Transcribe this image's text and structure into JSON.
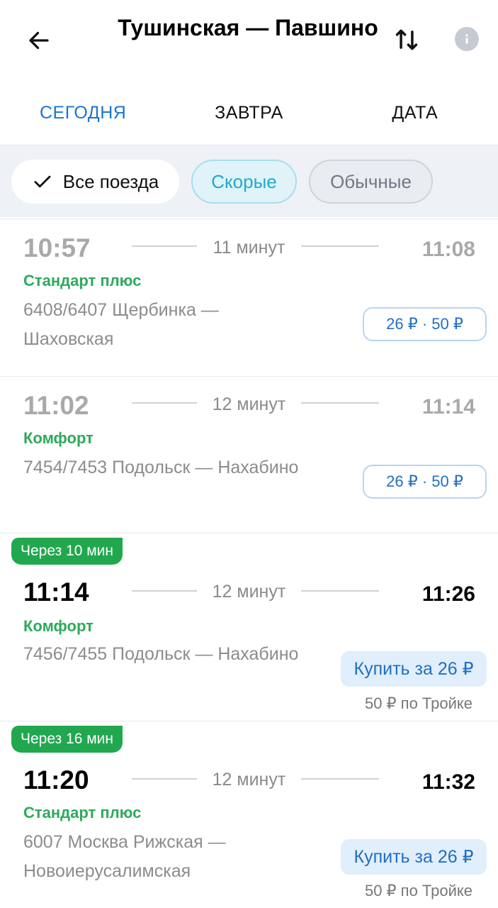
{
  "header": {
    "title": "Тушинская — Павшино",
    "back_icon": "arrow-left-icon",
    "swap_icon": "swap-vertical-icon",
    "info_icon": "info-icon"
  },
  "tabs": [
    {
      "label": "СЕГОДНЯ",
      "active": true
    },
    {
      "label": "ЗАВТРА",
      "active": false
    },
    {
      "label": "ДАТА",
      "active": false
    }
  ],
  "filters": {
    "all": "Все поезда",
    "fast": "Скорые",
    "regular": "Обычные"
  },
  "colors": {
    "accent_blue": "#1976d2",
    "green": "#21a84f",
    "type_green": "#2eaa5c"
  },
  "trains": [
    {
      "departure": "10:57",
      "duration": "11 минут",
      "arrival": "11:08",
      "type": "Стандарт плюс",
      "route": "6408/6407 Щербинка — Шаховская",
      "price": "26 ₽ · 50 ₽",
      "past": true
    },
    {
      "departure": "11:02",
      "duration": "12 минут",
      "arrival": "11:14",
      "type": "Комфорт",
      "route": "7454/7453 Подольск — Нахабино",
      "price": "26 ₽ · 50 ₽",
      "past": true
    },
    {
      "badge": "Через 10 мин",
      "departure": "11:14",
      "duration": "12 минут",
      "arrival": "11:26",
      "type": "Комфорт",
      "route": "7456/7455 Подольск — Нахабино",
      "buy": "Купить за 26 ₽",
      "troika": "50 ₽ по Тройке",
      "past": false
    },
    {
      "badge": "Через 16 мин",
      "departure": "11:20",
      "duration": "12 минут",
      "arrival": "11:32",
      "type": "Стандарт плюс",
      "route": "6007 Москва Рижская — Новоиерусалимская",
      "buy": "Купить за 26 ₽",
      "troika": "50 ₽ по Тройке",
      "past": false
    }
  ]
}
